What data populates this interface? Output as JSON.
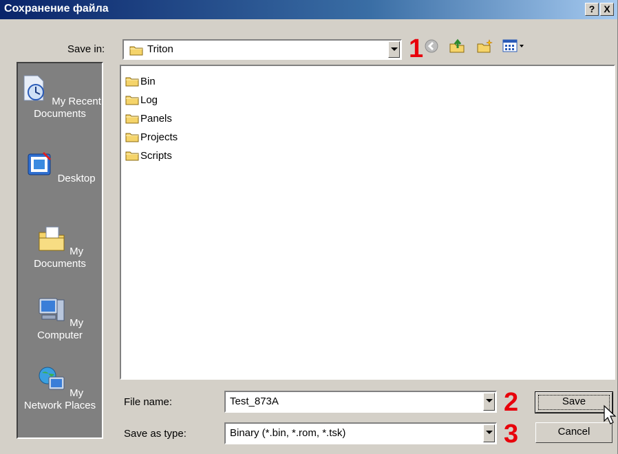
{
  "window": {
    "title": "Сохранение файла",
    "help_label": "?",
    "close_label": "X"
  },
  "toolbar": {
    "save_in_label": "Save in:",
    "save_in_value": "Triton",
    "marker_1": "1"
  },
  "places": [
    {
      "label": "My Recent Documents",
      "icon": "recent-documents-icon"
    },
    {
      "label": "Desktop",
      "icon": "desktop-icon"
    },
    {
      "label": "My Documents",
      "icon": "my-documents-icon"
    },
    {
      "label": "My Computer",
      "icon": "my-computer-icon"
    },
    {
      "label": "My Network Places",
      "icon": "network-places-icon"
    }
  ],
  "files": [
    "Bin",
    "Log",
    "Panels",
    "Projects",
    "Scripts"
  ],
  "form": {
    "file_name_label": "File name:",
    "file_name_value": "Test_873A",
    "save_type_label": "Save as type:",
    "save_type_value": "Binary (*.bin, *.rom, *.tsk)",
    "marker_2": "2",
    "marker_3": "3"
  },
  "buttons": {
    "save": "Save",
    "cancel": "Cancel"
  },
  "colors": {
    "title_bar": "#0a246a",
    "dialog_face": "#d4d0c8",
    "places_bar": "#808080",
    "annotation_red": "#e8000b"
  }
}
